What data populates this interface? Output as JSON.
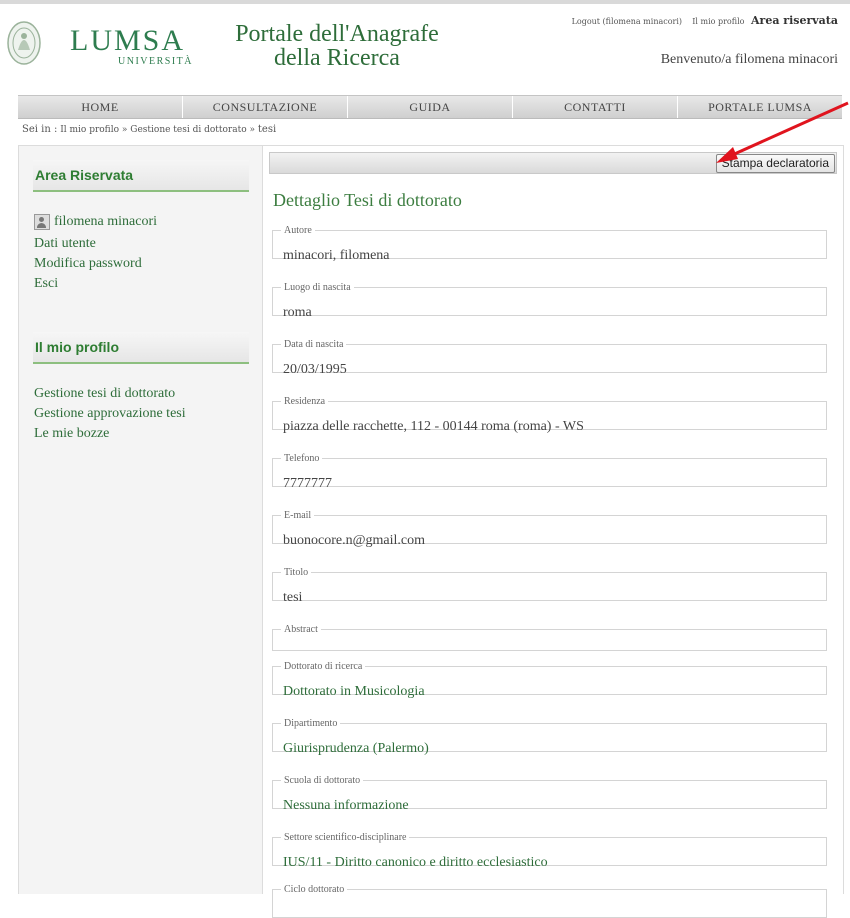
{
  "header": {
    "logo_word": "LUMSA",
    "logo_sub": "UNIVERSITÀ",
    "site_title_line1": "Portale dell'Anagrafe",
    "site_title_line2": "della Ricerca",
    "logout_link": "Logout (filomena minacori)",
    "profile_link": "Il mio profilo",
    "area_link": "Area riservata",
    "welcome": "Benvenuto/a filomena minacori"
  },
  "nav": {
    "items": [
      {
        "label": "HOME"
      },
      {
        "label": "CONSULTAZIONE"
      },
      {
        "label": "GUIDA"
      },
      {
        "label": "CONTATTI"
      },
      {
        "label": "PORTALE LUMSA"
      }
    ]
  },
  "breadcrumb": {
    "lead": "Sei in :",
    "crumb1": "Il mio profilo",
    "crumb2": "Gestione tesi di dottorato",
    "crumb3": "tesi",
    "sep": "»"
  },
  "sidebar": {
    "reserved_title": "Area Riservata",
    "user_name": "filomena minacori",
    "reserved_items": [
      "Dati utente",
      "Modifica password",
      "Esci"
    ],
    "profile_title": "Il mio profilo",
    "profile_items": [
      "Gestione tesi di dottorato",
      "Gestione approvazione tesi",
      "Le mie bozze"
    ]
  },
  "main": {
    "print_button": "Stampa declaratoria",
    "section_title": "Dettaglio Tesi di dottorato",
    "fields": [
      {
        "label": "Autore",
        "value": "minacori, filomena"
      },
      {
        "label": "Luogo di nascita",
        "value": "roma"
      },
      {
        "label": "Data di nascita",
        "value": "20/03/1995"
      },
      {
        "label": "Residenza",
        "value": "piazza delle racchette, 112 - 00144 roma (roma) - WS"
      },
      {
        "label": "Telefono",
        "value": "7777777"
      },
      {
        "label": "E-mail",
        "value": "buonocore.n@gmail.com"
      },
      {
        "label": "Titolo",
        "value": "tesi"
      },
      {
        "label": "Abstract",
        "value": ""
      },
      {
        "label": "Dottorato di ricerca",
        "value": "Dottorato in Musicologia"
      },
      {
        "label": "Dipartimento",
        "value": "Giurisprudenza (Palermo)"
      },
      {
        "label": "Scuola di dottorato",
        "value": "Nessuna informazione"
      },
      {
        "label": "Settore scientifico-disciplinare",
        "value": "IUS/11 - Diritto canonico e diritto ecclesiastico"
      },
      {
        "label": "Ciclo dottorato",
        "value": ""
      }
    ]
  },
  "colors": {
    "brand_green": "#2e7d4f",
    "annotation_arrow": "#e0141e"
  }
}
